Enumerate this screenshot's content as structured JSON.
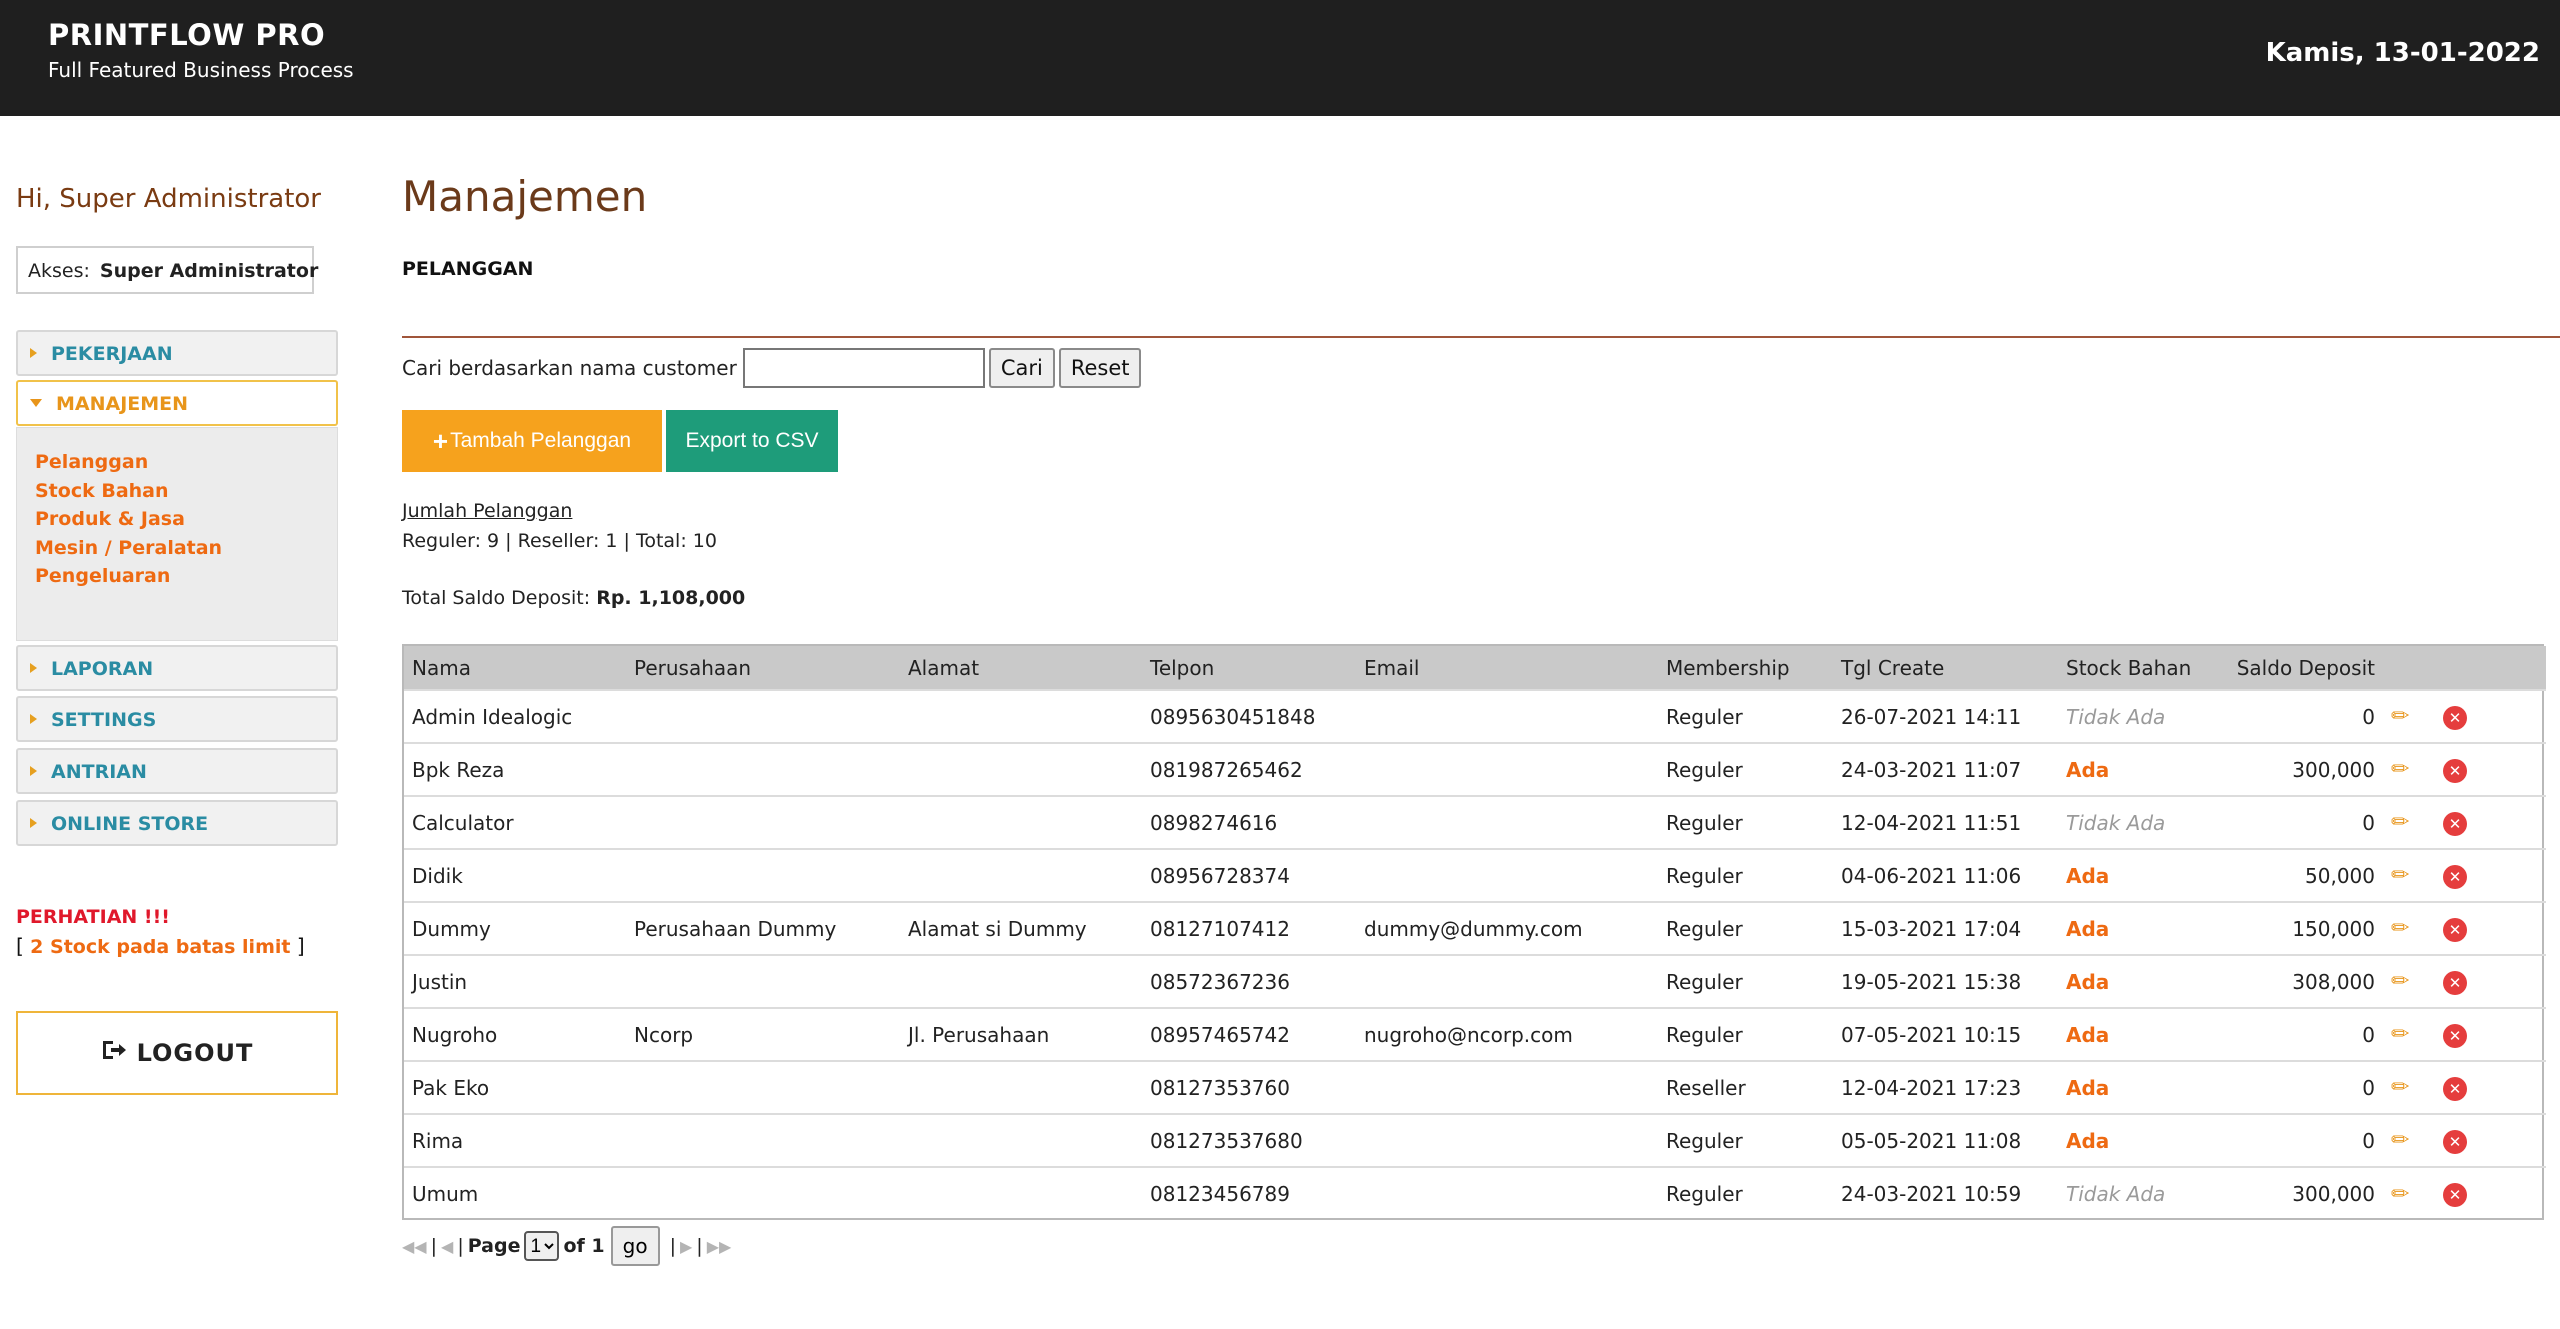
{
  "header": {
    "brand": "PRINTFLOW PRO",
    "tagline": "Full Featured Business Process",
    "date": "Kamis, 13-01-2022"
  },
  "sidebar": {
    "greeting": "Hi, Super Administrator",
    "akses_label": "Akses:",
    "akses_value": "Super Administrator",
    "menu": [
      {
        "label": "PEKERJAAN"
      },
      {
        "label": "MANAJEMEN"
      },
      {
        "label": "LAPORAN"
      },
      {
        "label": "SETTINGS"
      },
      {
        "label": "ANTRIAN"
      },
      {
        "label": "ONLINE STORE"
      }
    ],
    "submenu": [
      "Pelanggan",
      "Stock Bahan",
      "Produk & Jasa",
      "Mesin / Peralatan",
      "Pengeluaran"
    ],
    "warning_title": "PERHATIAN !!!",
    "warning_open": "[",
    "warning_link": "2 Stock pada batas limit",
    "warning_close": "]",
    "logout": "LOGOUT"
  },
  "main": {
    "title": "Manajemen",
    "section": "PELANGGAN",
    "search_label": "Cari berdasarkan nama customer",
    "search_value": "",
    "search_button": "Cari",
    "reset_button": "Reset",
    "add_button": "Tambah Pelanggan",
    "export_button": "Export to CSV",
    "jumlah_label": "Jumlah Pelanggan",
    "counts": "Reguler: 9 | Reseller: 1 | Total: 10",
    "saldo_label": "Total Saldo Deposit:",
    "saldo_value": "Rp. 1,108,000"
  },
  "table": {
    "columns": [
      "Nama",
      "Perusahaan",
      "Alamat",
      "Telpon",
      "Email",
      "Membership",
      "Tgl Create",
      "Stock Bahan",
      "Saldo Deposit"
    ],
    "rows": [
      {
        "nama": "Admin Idealogic",
        "perusahaan": "",
        "alamat": "",
        "telpon": "0895630451848",
        "email": "",
        "membership": "Reguler",
        "tgl": "26-07-2021 14:11",
        "stock": "Tidak Ada",
        "saldo": "0"
      },
      {
        "nama": "Bpk Reza",
        "perusahaan": "",
        "alamat": "",
        "telpon": "081987265462",
        "email": "",
        "membership": "Reguler",
        "tgl": "24-03-2021 11:07",
        "stock": "Ada",
        "saldo": "300,000"
      },
      {
        "nama": "Calculator",
        "perusahaan": "",
        "alamat": "",
        "telpon": "0898274616",
        "email": "",
        "membership": "Reguler",
        "tgl": "12-04-2021 11:51",
        "stock": "Tidak Ada",
        "saldo": "0"
      },
      {
        "nama": "Didik",
        "perusahaan": "",
        "alamat": "",
        "telpon": "08956728374",
        "email": "",
        "membership": "Reguler",
        "tgl": "04-06-2021 11:06",
        "stock": "Ada",
        "saldo": "50,000"
      },
      {
        "nama": "Dummy",
        "perusahaan": "Perusahaan Dummy",
        "alamat": "Alamat si Dummy",
        "telpon": "08127107412",
        "email": "dummy@dummy.com",
        "membership": "Reguler",
        "tgl": "15-03-2021 17:04",
        "stock": "Ada",
        "saldo": "150,000"
      },
      {
        "nama": "Justin",
        "perusahaan": "",
        "alamat": "",
        "telpon": "08572367236",
        "email": "",
        "membership": "Reguler",
        "tgl": "19-05-2021 15:38",
        "stock": "Ada",
        "saldo": "308,000"
      },
      {
        "nama": "Nugroho",
        "perusahaan": "Ncorp",
        "alamat": "Jl. Perusahaan",
        "telpon": "08957465742",
        "email": "nugroho@ncorp.com",
        "membership": "Reguler",
        "tgl": "07-05-2021 10:15",
        "stock": "Ada",
        "saldo": "0"
      },
      {
        "nama": "Pak Eko",
        "perusahaan": "",
        "alamat": "",
        "telpon": "08127353760",
        "email": "",
        "membership": "Reseller",
        "tgl": "12-04-2021 17:23",
        "stock": "Ada",
        "saldo": "0"
      },
      {
        "nama": "Rima",
        "perusahaan": "",
        "alamat": "",
        "telpon": "081273537680",
        "email": "",
        "membership": "Reguler",
        "tgl": "05-05-2021 11:08",
        "stock": "Ada",
        "saldo": "0"
      },
      {
        "nama": "Umum",
        "perusahaan": "",
        "alamat": "",
        "telpon": "08123456789",
        "email": "",
        "membership": "Reguler",
        "tgl": "24-03-2021 10:59",
        "stock": "Tidak Ada",
        "saldo": "300,000"
      }
    ]
  },
  "pager": {
    "page_label": "Page",
    "page_value": "1",
    "of_label": "of 1",
    "go": "go"
  },
  "colors": {
    "header_bg": "#1f1f1f",
    "accent_orange": "#f6a21d",
    "accent_green": "#1e9c7a",
    "link_orange": "#ee6a12",
    "menu_teal": "#2a8ca3",
    "danger_red": "#e53d3d"
  },
  "icons": {
    "edit": "pencil-icon",
    "delete": "delete-circle-icon",
    "logout": "logout-icon",
    "menu_caret": "caret-icon"
  }
}
